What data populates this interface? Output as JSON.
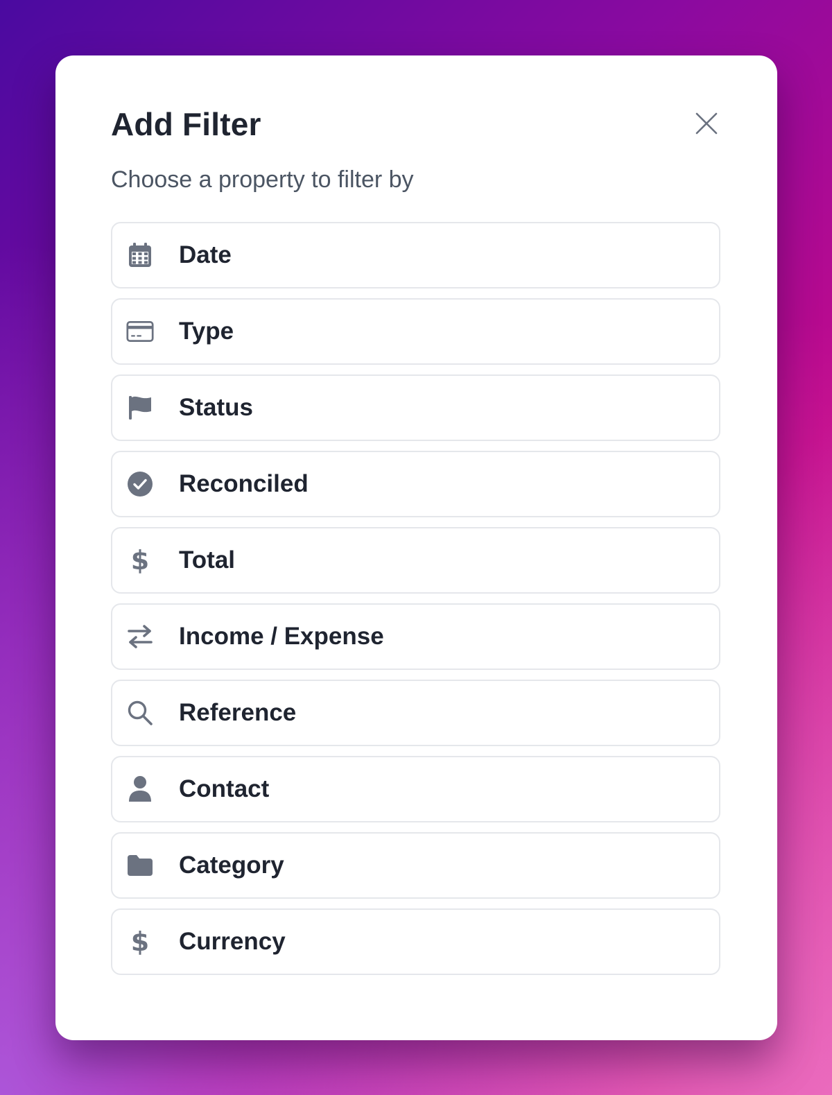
{
  "modal": {
    "title": "Add Filter",
    "subtitle": "Choose a property to filter by",
    "close_icon": "close-icon"
  },
  "options": [
    {
      "label": "Date",
      "icon": "calendar-icon"
    },
    {
      "label": "Type",
      "icon": "credit-card-icon"
    },
    {
      "label": "Status",
      "icon": "flag-icon"
    },
    {
      "label": "Reconciled",
      "icon": "check-circle-icon"
    },
    {
      "label": "Total",
      "icon": "dollar-icon"
    },
    {
      "label": "Income / Expense",
      "icon": "arrows-swap-icon"
    },
    {
      "label": "Reference",
      "icon": "search-icon"
    },
    {
      "label": "Contact",
      "icon": "user-icon"
    },
    {
      "label": "Category",
      "icon": "folder-icon"
    },
    {
      "label": "Currency",
      "icon": "dollar-icon"
    }
  ],
  "colors": {
    "icon": "#6b7280",
    "text": "#1f2430",
    "subtitle": "#4b5563",
    "border": "#e5e7eb",
    "background_gradient_start": "#4a0aa0",
    "background_gradient_end": "#e45ab0"
  }
}
